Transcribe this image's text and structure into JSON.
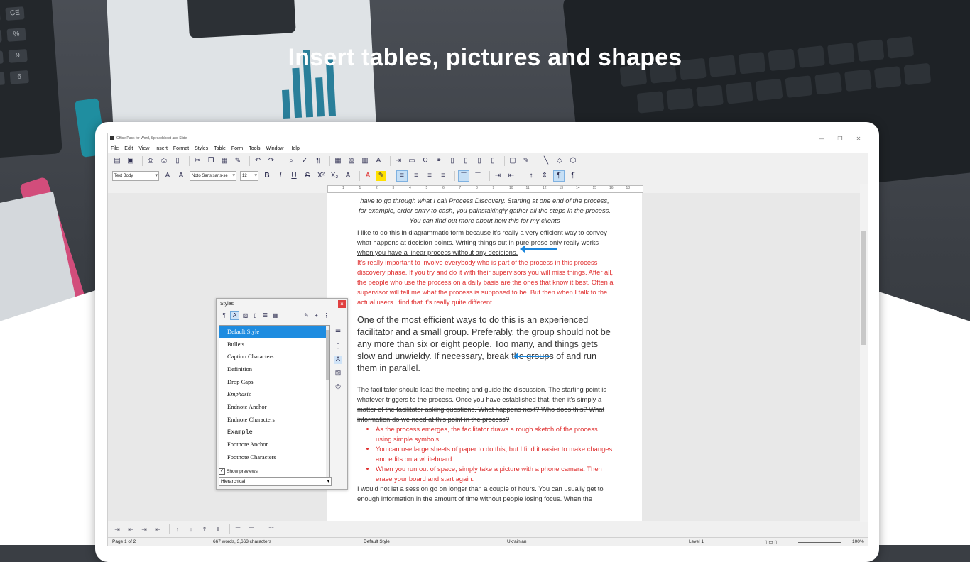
{
  "headline": "Insert tables, pictures and shapes",
  "window": {
    "title": "Office Pack for Word, Spreadsheet and Slide",
    "controls": [
      "—",
      "❐",
      "✕"
    ]
  },
  "menu": [
    "File",
    "Edit",
    "View",
    "Insert",
    "Format",
    "Styles",
    "Table",
    "Form",
    "Tools",
    "Window",
    "Help"
  ],
  "formatting": {
    "paragraph_style": "Text Body",
    "font_name": "Noto Sans;sans-se",
    "font_size": "12"
  },
  "ruler_ticks": [
    "1",
    "1",
    "2",
    "3",
    "4",
    "5",
    "6",
    "7",
    "8",
    "9",
    "10",
    "11",
    "12",
    "13",
    "14",
    "15",
    "16",
    "18"
  ],
  "document": {
    "italic_para": "have to go through what I call Process Discovery. Starting at one end of the process, for example, order entry to cash, you painstakingly gather all the steps in the process. You can find out more about how this for my clients",
    "underlined_para": "I like to do this in diagrammatic form because it's really a very efficient way to convey what happens at decision points. Writing things out in pure prose only really works when you have a linear process without any decisions.",
    "red_para": "It's really important to involve everybody who is part of the process in this process discovery phase. If you try and do it with their supervisors you will miss things. After all, the people who use the process on a daily basis are the ones that know it best. Often a supervisor will tell me what the process is supposed to be. But then when I talk to the actual users I find that it's really quite different.",
    "big_para": "One of the most efficient ways to do this is an experienced facilitator and a small group. Preferably, the group should not be any more than six or eight people. Too many, and things gets slow and unwieldy. If necessary, break the groups of and run them in parallel.",
    "strike_para": "The facilitator should lead the meeting and guide the discussion. The starting point is whatever triggers to the process. Once you have established that, then it's simply a matter of the facilitator asking questions. What happens next? Who does this? What information do we need at this point in the process?",
    "bullets": [
      "As the process emerges, the facilitator draws a rough sketch of the process using simple symbols.",
      "You can use large sheets of paper to do this, but I find it easier to make changes and edits on a whiteboard.",
      "When you run out of space, simply take a picture with a phone camera. Then erase your board and start again."
    ],
    "last_para": "I would not let a session go on longer than a couple of hours. You can usually get to enough information in the amount of time without people losing focus. When the"
  },
  "styles_panel": {
    "title": "Styles",
    "items": [
      "Default Style",
      "Bullets",
      "Caption Characters",
      "Definition",
      "Drop Caps",
      "Emphasis",
      "Endnote Anchor",
      "Endnote Characters",
      "Example",
      "Footnote Anchor",
      "Footnote Characters"
    ],
    "selected": "Default Style",
    "show_previews_label": "Show previews",
    "show_previews_checked": true,
    "filter": "Hierarchical"
  },
  "status": {
    "page": "Page 1 of 2",
    "words": "667 words, 3,663 characters",
    "style": "Default Style",
    "language": "Ukrainian",
    "level": "Level 1",
    "zoom": "100%"
  },
  "colors": {
    "accent": "#1e8ce0",
    "red_text": "#e03030",
    "arrow": "#1b86dc"
  }
}
